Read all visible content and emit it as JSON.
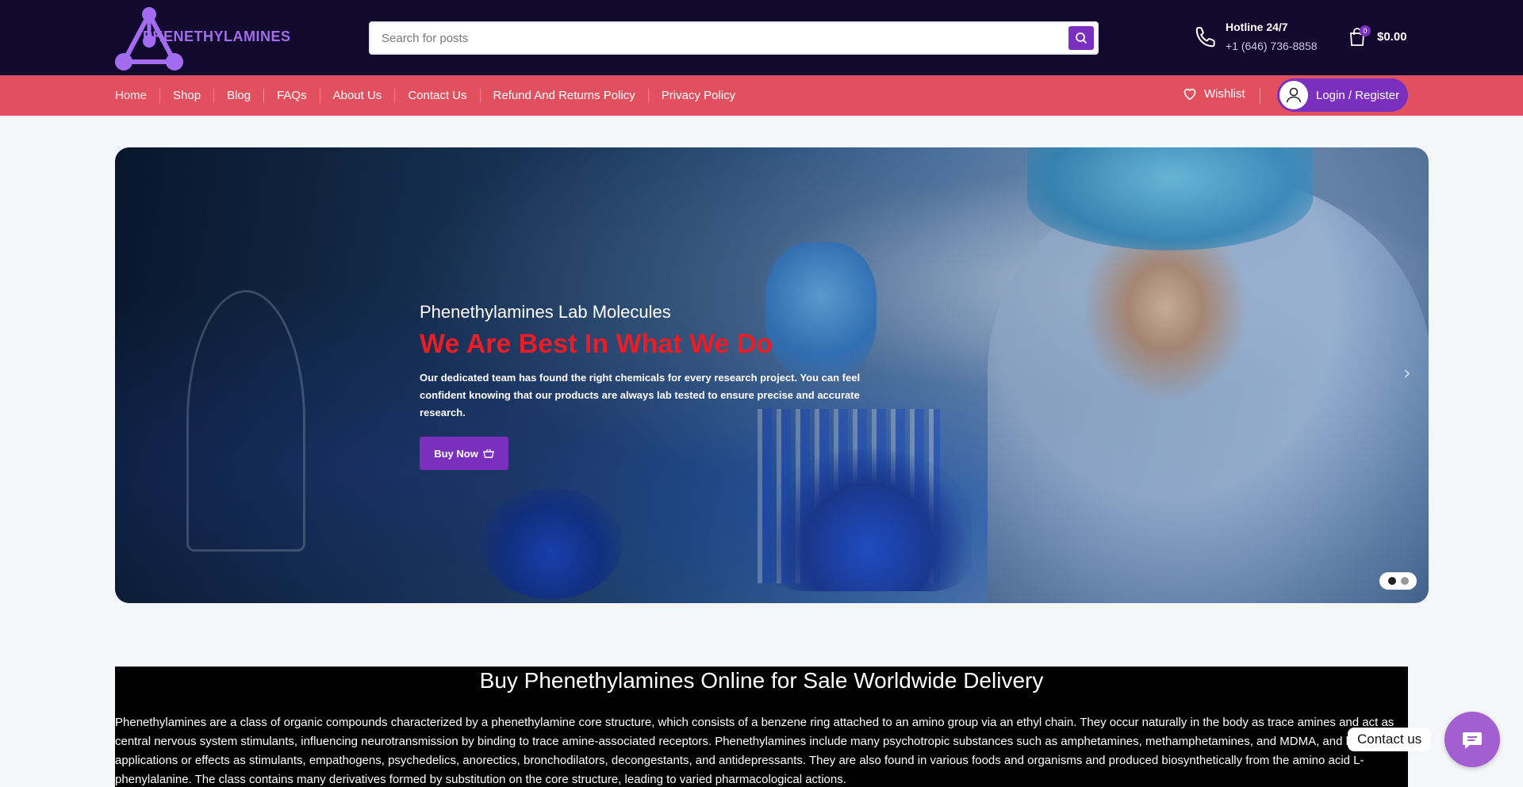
{
  "brand": {
    "name": "PHENETHYLAMINES"
  },
  "search": {
    "placeholder": "Search for posts"
  },
  "hotline": {
    "title": "Hotline 24/7",
    "number": "+1 (646) 736-8858"
  },
  "cart": {
    "count": "0",
    "amount": "$0.00"
  },
  "nav": {
    "items": [
      {
        "label": "Home"
      },
      {
        "label": "Shop"
      },
      {
        "label": "Blog"
      },
      {
        "label": "FAQs"
      },
      {
        "label": "About Us"
      },
      {
        "label": "Contact Us"
      },
      {
        "label": "Refund And Returns Policy"
      },
      {
        "label": "Privacy Policy"
      }
    ],
    "wishlist_label": "Wishlist",
    "login_label": "Login / Register"
  },
  "hero": {
    "subtitle": "Phenethylamines Lab Molecules",
    "title": "We Are Best In What We Do",
    "text": "Our dedicated team has found the right chemicals for every research project. You can feel confident knowing that our products are always lab tested to ensure precise and accurate research.",
    "button_label": "Buy Now",
    "slides": 2,
    "active_slide": 1
  },
  "about": {
    "heading": "Buy Phenethylamines Online for Sale Worldwide Delivery",
    "paragraph": "Phenethylamines are a class of organic compounds characterized by a phenethylamine core structure, which consists of a benzene ring attached to an amino group via an ethyl chain. They occur naturally in the body as trace amines and act as central nervous system stimulants, influencing neurotransmission by binding to trace amine-associated receptors. Phenethylamines include many psychotropic substances such as amphetamines, methamphetamines, and MDMA, and have applications or effects as stimulants, empathogens, psychedelics, anorectics, bronchodilators, decongestants, and antidepressants. They are also found in various foods and organisms and produced biosynthetically from the amino acid L-phenylalanine. The class contains many derivatives formed by substitution on the core structure, leading to varied pharmacological actions."
  },
  "contact_widget": {
    "label": "Contact us"
  },
  "colors": {
    "header_bg": "#120a2e",
    "nav_bg": "#e24f5e",
    "accent": "#7b2fbe",
    "hero_title": "#e81d25"
  }
}
